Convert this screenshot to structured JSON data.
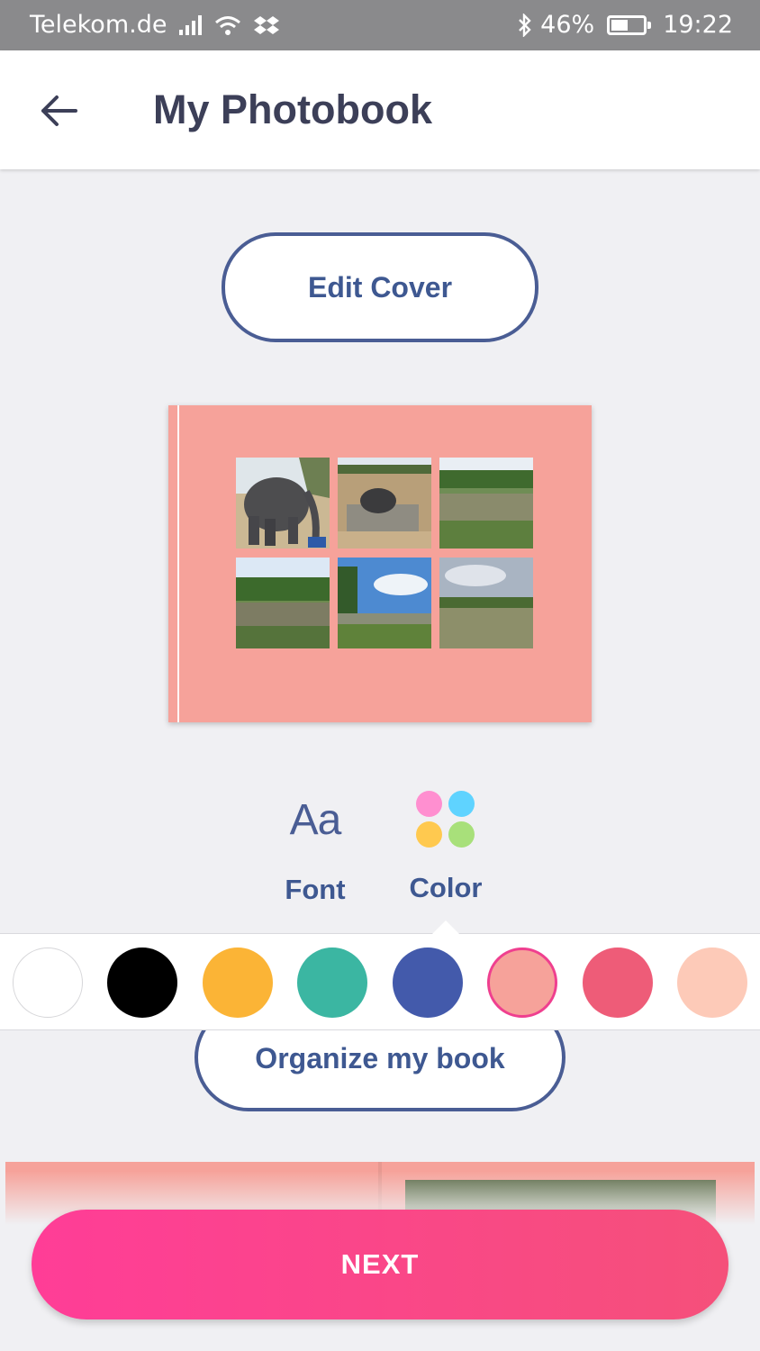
{
  "status_bar": {
    "carrier": "Telekom.de",
    "battery": "46%",
    "time": "19:22",
    "icons": [
      "signal-icon",
      "wifi-icon",
      "dropbox-icon",
      "bluetooth-icon",
      "battery-icon"
    ]
  },
  "header": {
    "title": "My Photobook",
    "back_icon": "arrow-left-icon"
  },
  "buttons": {
    "edit_cover": "Edit Cover",
    "organize": "Organize my book",
    "next": "NEXT"
  },
  "book": {
    "cover_color": "#f6a29a",
    "photos": [
      "elephant",
      "elephant-pool",
      "pond",
      "lake",
      "field",
      "meadow"
    ]
  },
  "tools": {
    "font": {
      "glyph": "Aa",
      "label": "Font"
    },
    "color": {
      "label": "Color",
      "selected": true
    }
  },
  "palette": {
    "selected": "#f6a29a",
    "colors": [
      "#ffffff",
      "#000000",
      "#fbb436",
      "#3bb6a2",
      "#435aab",
      "#f6a29a",
      "#ee5c78",
      "#fdcab8"
    ]
  },
  "colors": {
    "accent": "#ff3d97",
    "title": "#3c3f58",
    "outline": "#4a5d94"
  }
}
